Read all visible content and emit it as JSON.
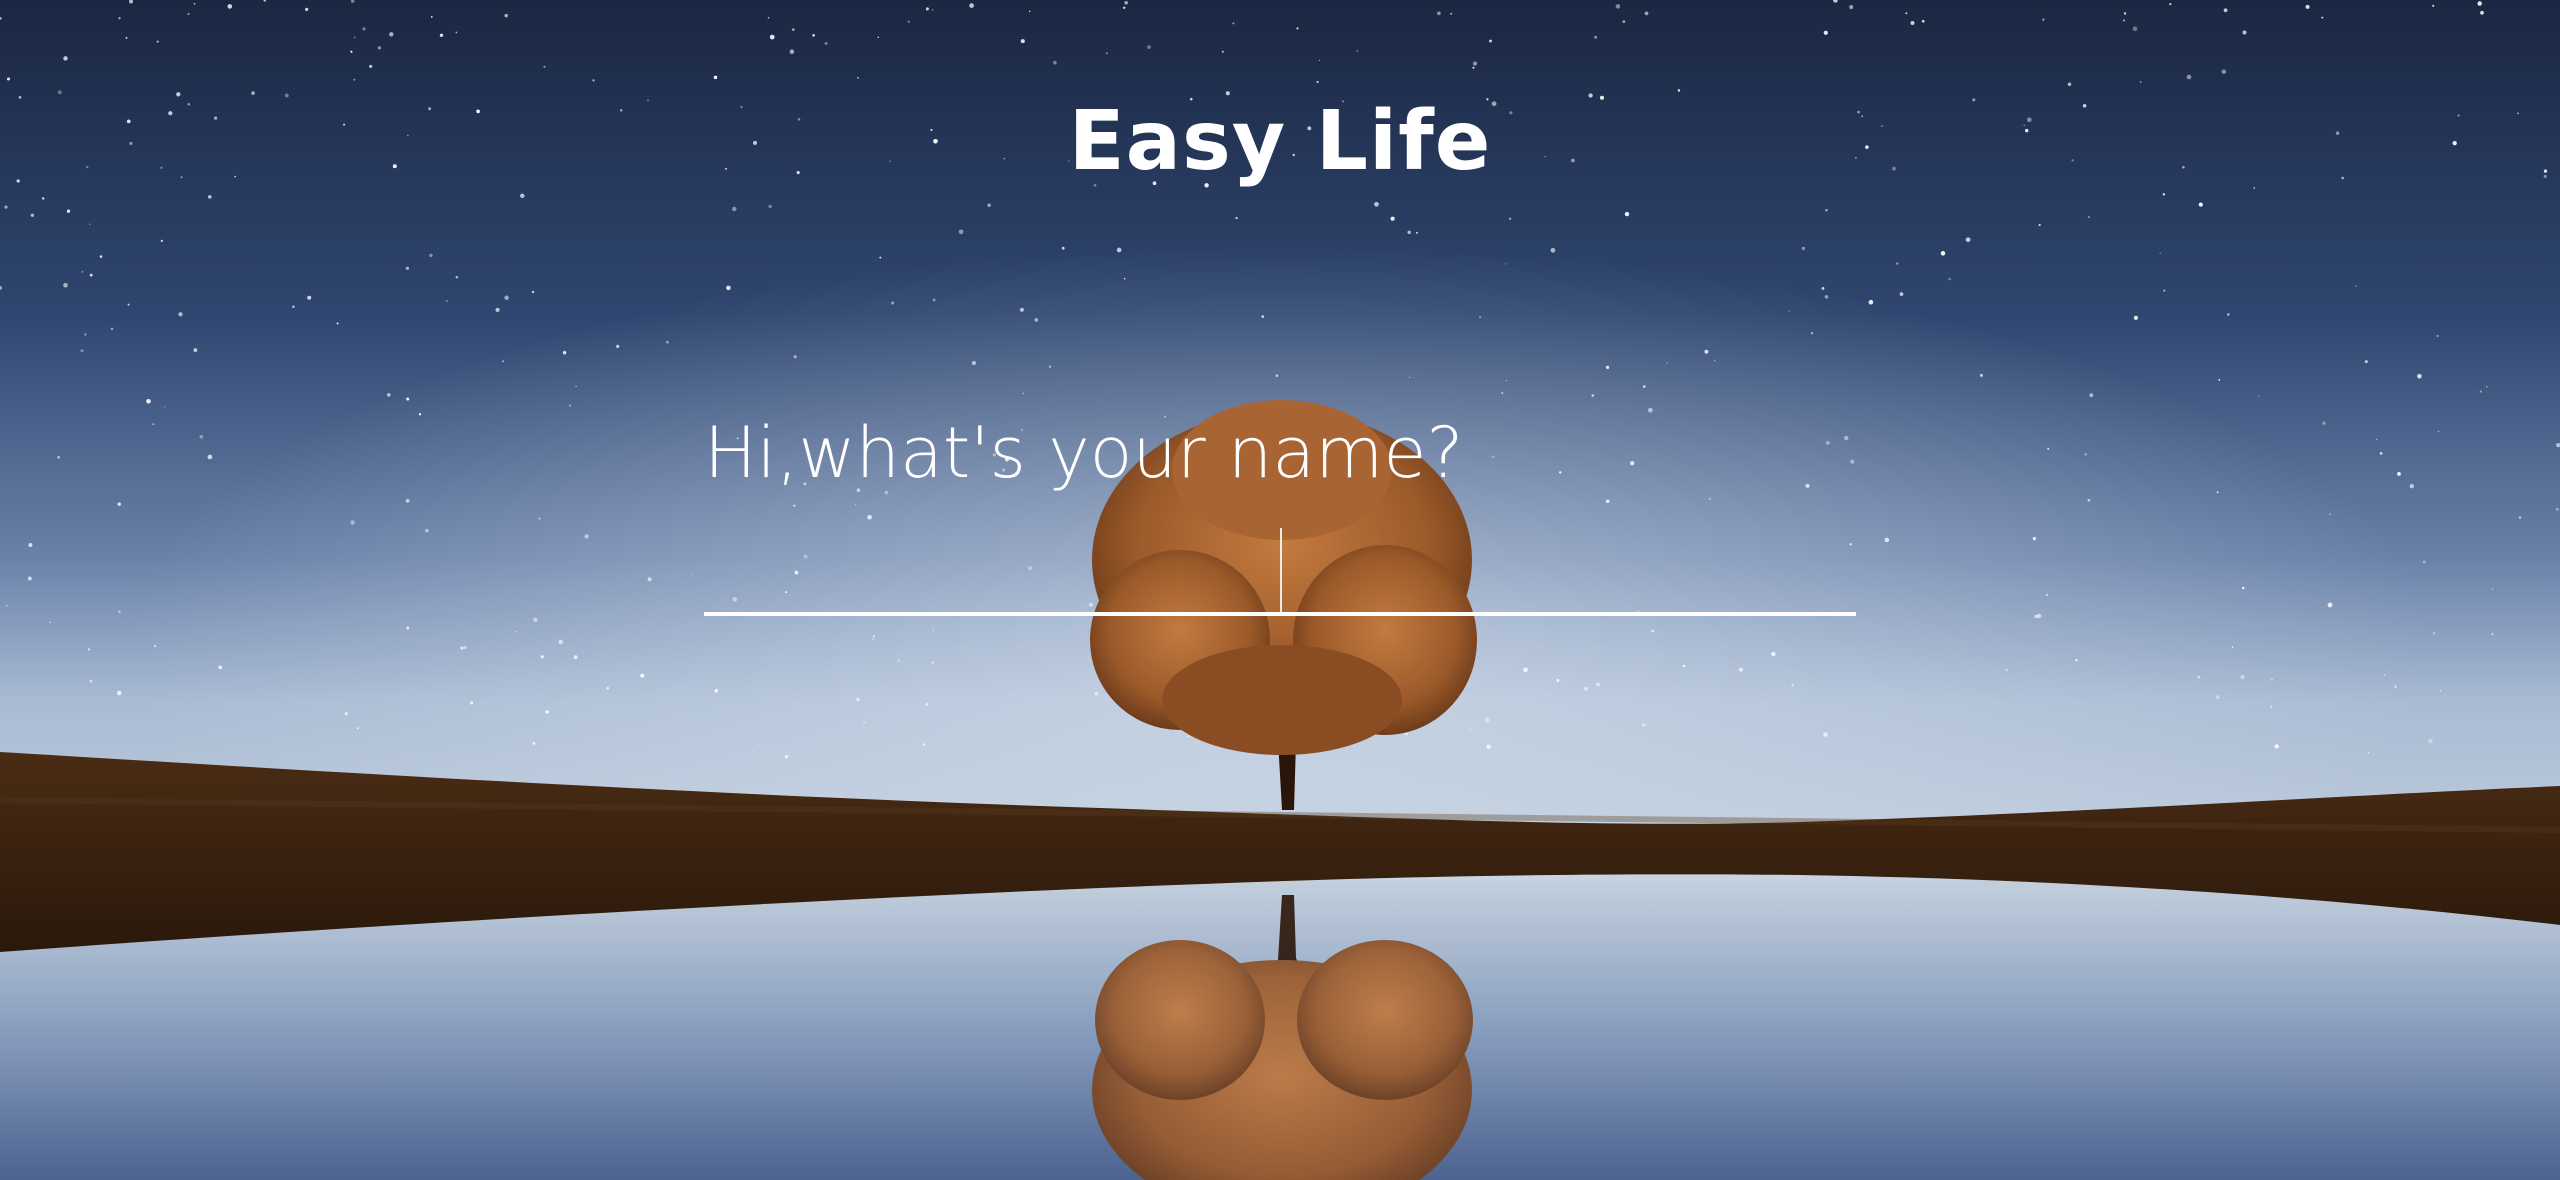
{
  "app": {
    "title": "Easy Life"
  },
  "greeting": {
    "prompt": "Hi,what's your name?",
    "name_value": "",
    "placeholder": ""
  },
  "colors": {
    "text": "#ffffff",
    "sky_top": "#1b2742",
    "sky_horizon": "#aebfd6",
    "tree_foliage": "#b06a36",
    "ground": "#3a2211"
  }
}
